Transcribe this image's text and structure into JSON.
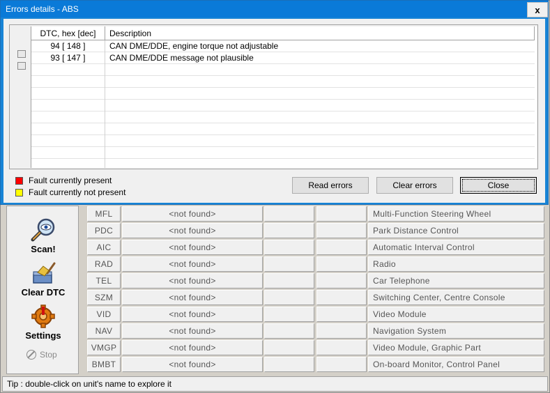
{
  "dialog": {
    "title": "Errors details - ABS",
    "close_glyph": "x",
    "grid": {
      "columns": [
        "DTC, hex [dec]",
        "Description"
      ],
      "rows": [
        {
          "code": "94 [ 148 ]",
          "description": "CAN DME/DDE, engine torque not adjustable"
        },
        {
          "code": "93 [ 147 ]",
          "description": "CAN DME/DDE message not plausible"
        }
      ],
      "empty_rows": 9
    },
    "legend": [
      {
        "label": "Fault currently present",
        "color": "#ff0000"
      },
      {
        "label": "Fault currently not present",
        "color": "#ffff00"
      }
    ],
    "buttons": {
      "read": "Read errors",
      "clear": "Clear errors",
      "close": "Close"
    }
  },
  "toolbar": {
    "scan": "Scan!",
    "clear_dtc": "Clear DTC",
    "settings": "Settings",
    "stop": "Stop"
  },
  "units": [
    {
      "code": "MFL",
      "status": "<not found>",
      "name": "Multi-Function Steering Wheel"
    },
    {
      "code": "PDC",
      "status": "<not found>",
      "name": "Park Distance Control"
    },
    {
      "code": "AIC",
      "status": "<not found>",
      "name": "Automatic Interval Control"
    },
    {
      "code": "RAD",
      "status": "<not found>",
      "name": "Radio"
    },
    {
      "code": "TEL",
      "status": "<not found>",
      "name": "Car Telephone"
    },
    {
      "code": "SZM",
      "status": "<not found>",
      "name": "Switching Center, Centre Console"
    },
    {
      "code": "VID",
      "status": "<not found>",
      "name": "Video Module"
    },
    {
      "code": "NAV",
      "status": "<not found>",
      "name": "Navigation System"
    },
    {
      "code": "VMGP",
      "status": "<not found>",
      "name": "Video Module, Graphic Part"
    },
    {
      "code": "BMBT",
      "status": "<not found>",
      "name": "On-board Monitor, Control Panel"
    }
  ],
  "statusbar": {
    "tip": "Tip : double-click on unit's name to explore it"
  },
  "colors": {
    "title_bar": "#0a7ad8",
    "dialog_frame": "#1884d6",
    "fault_present": "#ff0000",
    "fault_not_present": "#ffff00"
  }
}
